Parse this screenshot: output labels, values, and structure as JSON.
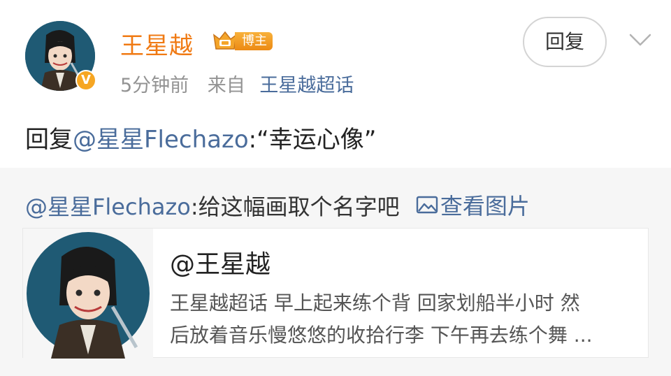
{
  "post": {
    "username": "王星越",
    "blogger_badge": "博主",
    "verified_badge": "V",
    "time": "5分钟前",
    "source_label": "来自",
    "source_name": "王星越超话",
    "reply_button": "回复",
    "reply_prefix": "回复",
    "reply_mention": "@星星Flechazo",
    "reply_body": ":“幸运心像”"
  },
  "quoted": {
    "mention": "@星星Flechazo",
    "body": ":给这幅画取个名字吧",
    "view_image_label": "查看图片",
    "card": {
      "title": "@王星越",
      "desc_line1": "王星越超话  早上起来练个背  回家划船半小时  然",
      "desc_line2": "后放着音乐慢悠悠的收拾行李  下午再去练个舞 ..."
    }
  },
  "colors": {
    "username": "#f07a13",
    "link": "#4a6c9b",
    "meta": "#939393",
    "quoted_bg": "#f6f6f6"
  },
  "icons": {
    "verified": "v-badge-icon",
    "crown": "crown-icon",
    "chevron": "chevron-down-icon",
    "image": "image-icon"
  }
}
